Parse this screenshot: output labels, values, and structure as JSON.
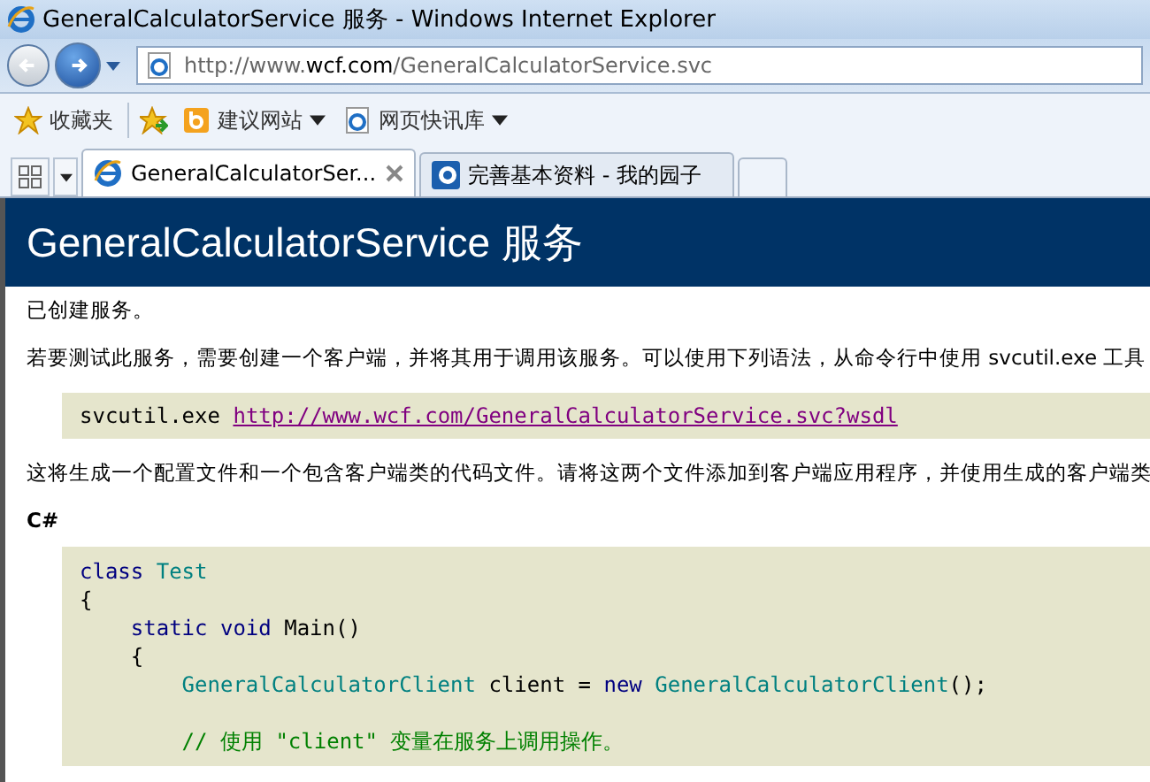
{
  "window": {
    "title": "GeneralCalculatorService 服务 - Windows Internet Explorer"
  },
  "address_bar": {
    "url_prefix": "http://www.",
    "url_domain": "wcf.com",
    "url_path": "/GeneralCalculatorService.svc"
  },
  "favorites_bar": {
    "favorites_label": "收藏夹",
    "links": [
      {
        "label": "建议网站",
        "kind": "suggest"
      },
      {
        "label": "网页快讯库",
        "kind": "ie"
      }
    ]
  },
  "tabs": [
    {
      "label": "GeneralCalculatorSer...",
      "selected": true,
      "closable": true,
      "kind": "ie"
    },
    {
      "label": "完善基本资料 - 我的园子",
      "selected": false,
      "closable": false,
      "kind": "site"
    }
  ],
  "page": {
    "heading": "GeneralCalculatorService 服务",
    "created_text": "已创建服务。",
    "intro_text": "若要测试此服务，需要创建一个客户端，并将其用于调用该服务。可以使用下列语法，从命令行中使用 svcutil.exe 工具",
    "command": {
      "program": "svcutil.exe",
      "link": "http://www.wcf.com/GeneralCalculatorService.svc?wsdl"
    },
    "generate_text": "这将生成一个配置文件和一个包含客户端类的代码文件。请将这两个文件添加到客户端应用程序，并使用生成的客户端类",
    "language_label": "C#",
    "code_lines": [
      {
        "kind": "code",
        "tokens": [
          {
            "text": "class",
            "kind": "keyword"
          },
          {
            "text": " Test",
            "kind": "type"
          }
        ]
      },
      {
        "kind": "code",
        "tokens": [
          {
            "text": "{",
            "kind": "plain"
          }
        ]
      },
      {
        "kind": "code",
        "tokens": [
          {
            "text": "    static void",
            "kind": "keyword"
          },
          {
            "text": " Main()",
            "kind": "plain"
          }
        ]
      },
      {
        "kind": "code",
        "tokens": [
          {
            "text": "    {",
            "kind": "plain"
          }
        ]
      },
      {
        "kind": "code",
        "tokens": [
          {
            "text": "        GeneralCalculatorClient",
            "kind": "type"
          },
          {
            "text": " client = ",
            "kind": "plain"
          },
          {
            "text": "new",
            "kind": "keyword"
          },
          {
            "text": " GeneralCalculatorClient",
            "kind": "type"
          },
          {
            "text": "();",
            "kind": "plain"
          }
        ]
      },
      {
        "kind": "blank"
      },
      {
        "kind": "code",
        "tokens": [
          {
            "text": "        // 使用 \"client\" 变量在服务上调用操作。",
            "kind": "comment"
          }
        ]
      }
    ]
  }
}
